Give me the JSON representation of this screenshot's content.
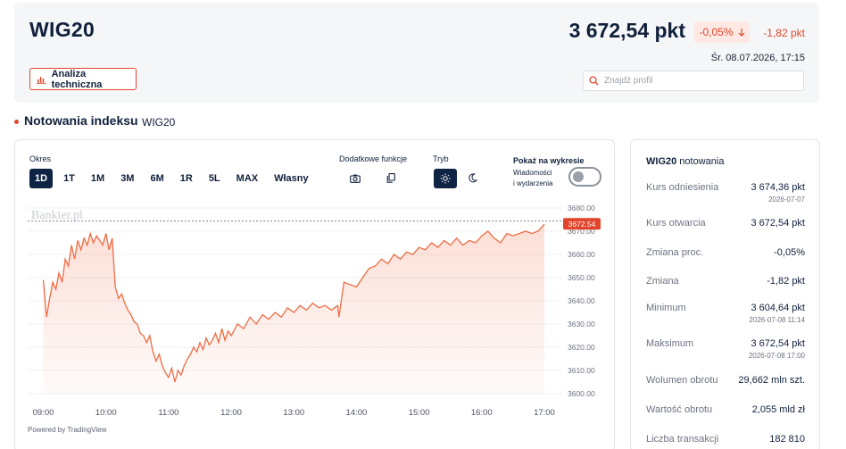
{
  "header": {
    "title": "WIG20",
    "price": "3 672,54 pkt",
    "change_pct": "-0,05%",
    "change_abs": "-1,82 pkt",
    "datetime": "Śr. 08.07.2026, 17:15",
    "ta_button": "Analiza techniczna",
    "search_placeholder": "Znajdź profil"
  },
  "section": {
    "title": "Notowania indeksu",
    "subtitle": "WIG20"
  },
  "controls": {
    "period_label": "Okres",
    "periods": [
      "1D",
      "1T",
      "1M",
      "3M",
      "6M",
      "1R",
      "5L",
      "MAX",
      "Własny"
    ],
    "active_period": "1D",
    "extra_label": "Dodatkowe funkcje",
    "mode_label": "Tryb",
    "show_label": "Pokaż na wykresie",
    "news_label_1": "Wiadomości",
    "news_label_2": "i wydarzenia",
    "powered_by": "Powered by TradingView",
    "watermark": "Bankier.pl"
  },
  "chart_data": {
    "type": "area",
    "x_ticks": [
      "09:00",
      "10:00",
      "11:00",
      "12:00",
      "13:00",
      "14:00",
      "15:00",
      "16:00",
      "17:00"
    ],
    "y_ticks": [
      3680,
      3670,
      3660,
      3650,
      3640,
      3630,
      3620,
      3610,
      3600
    ],
    "ylim": [
      3600,
      3680
    ],
    "last_value_label": "3672.54",
    "reference_value": 3674.36,
    "line_color": "#ef6c44",
    "x_hours": [
      9.0,
      9.05,
      9.1,
      9.15,
      9.2,
      9.25,
      9.3,
      9.35,
      9.4,
      9.45,
      9.5,
      9.55,
      9.6,
      9.65,
      9.7,
      9.75,
      9.8,
      9.85,
      9.9,
      9.95,
      10.0,
      10.05,
      10.1,
      10.15,
      10.2,
      10.25,
      10.3,
      10.35,
      10.4,
      10.45,
      10.5,
      10.55,
      10.6,
      10.65,
      10.7,
      10.75,
      10.8,
      10.85,
      10.9,
      10.95,
      11.0,
      11.05,
      11.1,
      11.15,
      11.2,
      11.25,
      11.3,
      11.35,
      11.4,
      11.45,
      11.5,
      11.55,
      11.6,
      11.65,
      11.7,
      11.75,
      11.8,
      11.85,
      11.9,
      11.95,
      12.0,
      12.1,
      12.2,
      12.3,
      12.4,
      12.5,
      12.6,
      12.7,
      12.8,
      12.9,
      13.0,
      13.1,
      13.2,
      13.3,
      13.4,
      13.5,
      13.6,
      13.7,
      13.72,
      13.8,
      13.9,
      14.0,
      14.1,
      14.2,
      14.3,
      14.4,
      14.5,
      14.6,
      14.7,
      14.8,
      14.9,
      15.0,
      15.1,
      15.2,
      15.3,
      15.4,
      15.5,
      15.6,
      15.7,
      15.8,
      15.9,
      16.0,
      16.1,
      16.2,
      16.3,
      16.4,
      16.5,
      16.6,
      16.7,
      16.8,
      16.9,
      17.0
    ],
    "values": [
      3649,
      3633,
      3641,
      3648,
      3645,
      3652,
      3648,
      3658,
      3655,
      3664,
      3658,
      3666,
      3662,
      3667,
      3664,
      3669,
      3665,
      3668,
      3666,
      3664,
      3669,
      3662,
      3667,
      3646,
      3641,
      3643,
      3639,
      3636,
      3634,
      3631,
      3630,
      3626,
      3625,
      3622,
      3625,
      3618,
      3614,
      3617,
      3612,
      3609,
      3607,
      3611,
      3605,
      3610,
      3608,
      3612,
      3615,
      3617,
      3620,
      3618,
      3622,
      3619,
      3624,
      3621,
      3623,
      3626,
      3622,
      3628,
      3623,
      3627,
      3625,
      3630,
      3628,
      3633,
      3630,
      3634,
      3632,
      3635,
      3633,
      3637,
      3635,
      3638,
      3636,
      3639,
      3637,
      3638,
      3636,
      3638,
      3633,
      3648,
      3647,
      3646,
      3650,
      3654,
      3655,
      3658,
      3656,
      3660,
      3658,
      3661,
      3660,
      3663,
      3662,
      3665,
      3663,
      3666,
      3664,
      3667,
      3664,
      3666,
      3665,
      3668,
      3670,
      3667,
      3665,
      3669,
      3668,
      3669,
      3670,
      3669,
      3670,
      3673
    ]
  },
  "stats": {
    "title_bold": "WIG20",
    "title_rest": "notowania",
    "rows": [
      {
        "label": "Kurs odniesienia",
        "value": "3 674,36 pkt",
        "date": "2026-07-07"
      },
      {
        "label": "Kurs otwarcia",
        "value": "3 672,54 pkt",
        "date": ""
      },
      {
        "label": "Zmiana proc.",
        "value": "-0,05%",
        "date": ""
      },
      {
        "label": "Zmiana",
        "value": "-1,82 pkt",
        "date": ""
      },
      {
        "label": "Minimum",
        "value": "3 604,64 pkt",
        "date": "2026-07-08 11:14"
      },
      {
        "label": "Maksimum",
        "value": "3 672,54 pkt",
        "date": "2026-07-08 17:00"
      },
      {
        "label": "Wolumen obrotu",
        "value": "29,662 mln szt.",
        "date": ""
      },
      {
        "label": "Wartość obrotu",
        "value": "2,055 mld zł",
        "date": ""
      },
      {
        "label": "Liczba transakcji",
        "value": "182 810",
        "date": ""
      }
    ]
  },
  "colors": {
    "accent": "#e2452b",
    "navy": "#0f2444"
  }
}
